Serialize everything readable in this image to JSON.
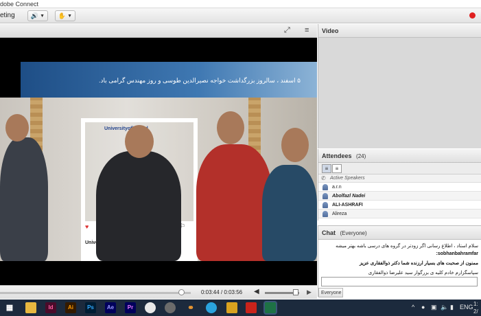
{
  "window": {
    "title": "dobe Connect"
  },
  "toolbar": {
    "meeting_label": "eting"
  },
  "share_pod": {
    "banner_text": "۵ اسفند ، سالروز بزرگداشت خواجه نصیرالدین طوسی و روز مهندس گرامی باد.",
    "frame_brand": "Universityofbirjand",
    "frame_caption": "Universityofbirjand",
    "player": {
      "elapsed": "0:03:44",
      "separator": "/",
      "duration": "0:03:56",
      "progress_fraction": 0.95,
      "volume_fraction": 0.9
    }
  },
  "video_pod": {
    "title": "Video"
  },
  "attendees": {
    "title": "Attendees",
    "count": "(24)",
    "section_label": "Active Speakers",
    "list": [
      "a.r.n",
      "Abolfazl Nadei",
      "ALI-ASHRAFI",
      "Alireza"
    ]
  },
  "chat": {
    "title": "Chat",
    "scope": "(Everyone)",
    "sender": "sobhanbahramfar:",
    "messages": [
      "سلام استاد ، اطلاع رسانی اگر زودتر در گروه های درسی باشه بهتر میشه",
      "ممنون از صحبت های بسیار ارزنده شما دکتر ذوالفقاری عزیز",
      "سپاسگزارم خادم کلیه ی بزرگوار سید علیرضا ذوالفقاری"
    ],
    "footer_scope": "Everyone"
  },
  "taskbar": {
    "apps": [
      "Id",
      "Ai",
      "Ps",
      "Ae",
      "Pr"
    ],
    "language": "ENG",
    "clock": "1:",
    "date": "2/"
  },
  "colors": {
    "record": "#e02020",
    "taskbar": "#1c2a3d",
    "banner": "#2b5f97"
  }
}
